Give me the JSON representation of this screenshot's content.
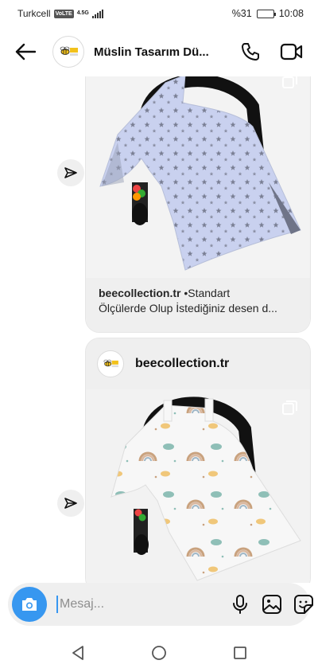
{
  "status_bar": {
    "carrier": "Turkcell",
    "volte": "VoLTE",
    "network": "4.5G",
    "battery_percent": "%31",
    "battery_level": 0.31,
    "time": "10:08"
  },
  "header": {
    "title": "Müslin Tasarım Dü...",
    "avatar_icon": "bee-logo-icon",
    "icons": [
      "back-arrow-icon",
      "phone-icon",
      "video-camera-icon"
    ]
  },
  "messages": [
    {
      "type": "shared_post",
      "image_icon": "multi-photo-icon",
      "caption_handle": "beecollection.tr",
      "caption_text": " •Standart",
      "caption_line2": "Ölçülerde Olup İstediğiniz desen d..."
    },
    {
      "type": "shared_post",
      "handle": "beecollection.tr",
      "image_icon": "multi-photo-icon"
    }
  ],
  "composer": {
    "placeholder": "Mesaj...",
    "value": "",
    "icons": [
      "camera-icon",
      "microphone-icon",
      "gallery-icon",
      "sticker-icon"
    ]
  },
  "colors": {
    "accent": "#3797f0",
    "bubble": "#efefef"
  }
}
